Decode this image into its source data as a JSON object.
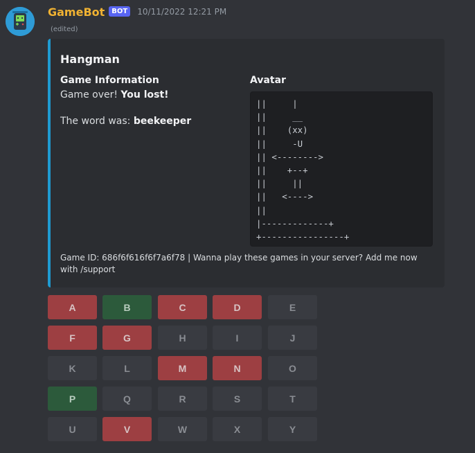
{
  "message": {
    "username": "GameBot",
    "bot_tag": "BOT",
    "timestamp": "10/11/2022 12:21 PM",
    "edited": "(edited)"
  },
  "embed": {
    "accent_color": "#1f9bd1",
    "title": "Hangman",
    "game_info": {
      "name": "Game Information",
      "line1_prefix": "Game over! ",
      "line1_bold": "You lost!",
      "line2_prefix": "The word was: ",
      "line2_bold": "beekeeper"
    },
    "avatar_field": {
      "name": "Avatar",
      "ascii": "||     |\n||     __\n||    (xx)\n||     -U\n|| <-------->\n||    +--+\n||     ||\n||   <---->\n||\n|-------------+\n+----------------+"
    },
    "footer": "Game ID: 686f6f616f6f7a6f78 | Wanna play these games in your server? Add me now with /support"
  },
  "keyboard": {
    "colors": {
      "gray": "#393b41",
      "red": "#9d3f42",
      "green": "#2c5a3b"
    },
    "rows": [
      [
        {
          "label": "A",
          "state": "red"
        },
        {
          "label": "B",
          "state": "green"
        },
        {
          "label": "C",
          "state": "red"
        },
        {
          "label": "D",
          "state": "red"
        },
        {
          "label": "E",
          "state": "gray"
        }
      ],
      [
        {
          "label": "F",
          "state": "red"
        },
        {
          "label": "G",
          "state": "red"
        },
        {
          "label": "H",
          "state": "gray"
        },
        {
          "label": "I",
          "state": "gray"
        },
        {
          "label": "J",
          "state": "gray"
        }
      ],
      [
        {
          "label": "K",
          "state": "gray"
        },
        {
          "label": "L",
          "state": "gray"
        },
        {
          "label": "M",
          "state": "red"
        },
        {
          "label": "N",
          "state": "red"
        },
        {
          "label": "O",
          "state": "gray"
        }
      ],
      [
        {
          "label": "P",
          "state": "green"
        },
        {
          "label": "Q",
          "state": "gray"
        },
        {
          "label": "R",
          "state": "gray"
        },
        {
          "label": "S",
          "state": "gray"
        },
        {
          "label": "T",
          "state": "gray"
        }
      ],
      [
        {
          "label": "U",
          "state": "gray"
        },
        {
          "label": "V",
          "state": "red"
        },
        {
          "label": "W",
          "state": "gray"
        },
        {
          "label": "X",
          "state": "gray"
        },
        {
          "label": "Y",
          "state": "gray"
        }
      ]
    ]
  }
}
